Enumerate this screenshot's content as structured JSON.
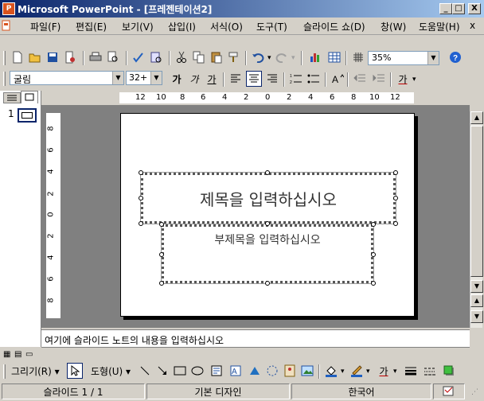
{
  "window": {
    "title": "Microsoft PowerPoint - [프레젠테이션2]",
    "app_icon_glyph": "P",
    "controls": {
      "minimize": "_",
      "maximize": "□",
      "close": "X"
    }
  },
  "menu": {
    "items": [
      "파일(F)",
      "편집(E)",
      "보기(V)",
      "삽입(I)",
      "서식(O)",
      "도구(T)",
      "슬라이드 쇼(D)",
      "창(W)",
      "도움말(H)"
    ],
    "close_glyph": "x"
  },
  "standard_toolbar": {
    "zoom": "35%",
    "icons": [
      "new-icon",
      "open-icon",
      "save-icon",
      "permission-icon",
      "print-icon",
      "print-preview-icon",
      "spelling-icon",
      "research-icon",
      "cut-icon",
      "copy-icon",
      "paste-icon",
      "format-painter-icon",
      "undo-icon",
      "redo-icon",
      "insert-chart-icon",
      "insert-table-icon",
      "show-grid-icon",
      "help-icon"
    ]
  },
  "formatting_toolbar": {
    "font": "굴림",
    "size": "32+",
    "bold": "가",
    "italic": "가",
    "underline": "가",
    "font_color_label": "가"
  },
  "ruler": {
    "horizontal_ticks": [
      "12",
      "10",
      "8",
      "6",
      "4",
      "2",
      "0",
      "2",
      "4",
      "6",
      "8",
      "10",
      "12"
    ],
    "vertical_ticks": [
      "8",
      "6",
      "4",
      "2",
      "0",
      "2",
      "4",
      "6",
      "8"
    ]
  },
  "outline_pane": {
    "tabs": [
      "outline-tab",
      "slides-tab"
    ],
    "slide_number": "1"
  },
  "slide": {
    "title_placeholder": "제목을 입력하십시오",
    "subtitle_placeholder": "부제목을 입력하십시오"
  },
  "notes": {
    "placeholder": "여기에 슬라이드 노트의 내용을 입력하십시오"
  },
  "drawing_toolbar": {
    "draw_menu": "그리기(R)",
    "autoshapes_menu": "도형(U)",
    "font_color_label": "가"
  },
  "status": {
    "slide": "슬라이드 1 / 1",
    "design": "기본 디자인",
    "language": "한국어"
  },
  "colors": {
    "titlebar_start": "#0a246a",
    "titlebar_end": "#a6caf0",
    "workspace": "#808080",
    "chrome": "#d4d0c8"
  }
}
